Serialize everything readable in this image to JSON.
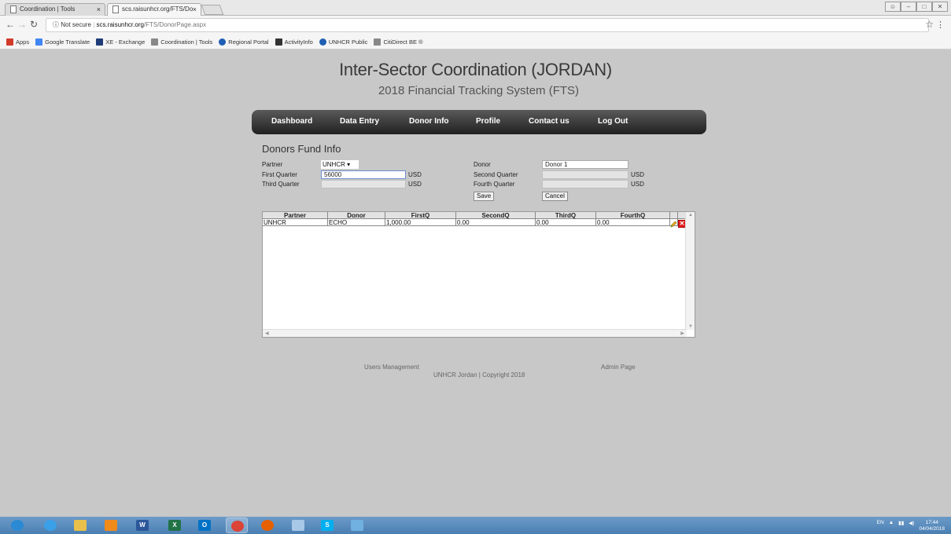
{
  "browser": {
    "tabs": [
      {
        "label": "Coordination | Tools"
      },
      {
        "label": "scs.raisunhcr.org/FTS/Do"
      }
    ],
    "url": {
      "security": "Not secure",
      "host": "scs.raisunhcr.org",
      "path": "/FTS/DonorPage.aspx"
    },
    "bookmarks": [
      {
        "label": "Apps",
        "icon": "apps-grid-icon",
        "color": "#d23a2a"
      },
      {
        "label": "Google Translate",
        "icon": "google-translate-icon",
        "color": "#4285f4"
      },
      {
        "label": "XE - Exchange",
        "icon": "xe-icon",
        "color": "#1e3c78"
      },
      {
        "label": "Coordination | Tools",
        "icon": "page-icon",
        "color": "#888888"
      },
      {
        "label": "Regional Portal",
        "icon": "unhcr-icon",
        "color": "#1f5fb4"
      },
      {
        "label": "ActivityInfo",
        "icon": "activityinfo-icon",
        "color": "#333333"
      },
      {
        "label": "UNHCR Public",
        "icon": "unhcr-icon",
        "color": "#1f5fb4"
      },
      {
        "label": "CitiDirect BE ®",
        "icon": "page-icon",
        "color": "#888888"
      }
    ]
  },
  "site": {
    "title": "Inter-Sector Coordination (JORDAN)",
    "subtitle": "2018 Financial Tracking System (FTS)"
  },
  "nav": {
    "items": [
      "Dashboard",
      "Data Entry",
      "Donor Info",
      "Profile",
      "Contact us",
      "Log Out"
    ]
  },
  "form": {
    "section_title": "Donors Fund Info",
    "partner_label": "Partner",
    "partner_value": "UNHCR",
    "first_quarter_label": "First Quarter",
    "first_quarter_value": "56000",
    "third_quarter_label": "Third Quarter",
    "third_quarter_value": "",
    "currency": "USD",
    "donor_label": "Donor",
    "donor_value": "Donor 1",
    "second_quarter_label": "Second Quarter",
    "second_quarter_value": "",
    "fourth_quarter_label": "Fourth Quarter",
    "fourth_quarter_value": "",
    "save_label": "Save",
    "cancel_label": "Cancel"
  },
  "grid": {
    "columns": [
      "Partner",
      "Donor",
      "FirstQ",
      "SecondQ",
      "ThirdQ",
      "FourthQ"
    ],
    "rows": [
      {
        "partner": "UNHCR",
        "donor": "ECHO",
        "firstq": "1,000.00",
        "secondq": "0.00",
        "thirdq": "0.00",
        "fourthq": "0.00"
      }
    ]
  },
  "footer": {
    "users_management": "Users Management",
    "admin_page": "Admin Page",
    "copyright": "UNHCR Jordan | Copyright 2018"
  },
  "taskbar": {
    "apps": [
      {
        "icon": "windows-start-icon",
        "color": "#2a8ad4"
      },
      {
        "icon": "internet-explorer-icon",
        "color": "#3aa0e8"
      },
      {
        "icon": "file-explorer-icon",
        "color": "#e8c04a"
      },
      {
        "icon": "media-player-icon",
        "color": "#f08a1a"
      },
      {
        "icon": "word-icon",
        "color": "#2b579a",
        "letter": "W"
      },
      {
        "icon": "excel-icon",
        "color": "#217346",
        "letter": "X"
      },
      {
        "icon": "outlook-icon",
        "color": "#0072c6",
        "letter": "O"
      },
      {
        "icon": "chrome-icon",
        "color": "#db4437"
      },
      {
        "icon": "firefox-icon",
        "color": "#e66000"
      },
      {
        "icon": "notepad-icon",
        "color": "#a8c8e8"
      },
      {
        "icon": "skype-icon",
        "color": "#00aff0",
        "letter": "S"
      },
      {
        "icon": "paint-icon",
        "color": "#6fb0e0"
      }
    ],
    "language": "EN",
    "time": "17:44",
    "date": "04/04/2018"
  }
}
